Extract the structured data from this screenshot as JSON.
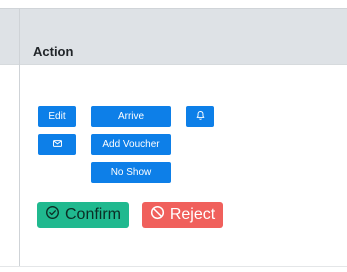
{
  "table": {
    "header": {
      "action_label": "Action"
    }
  },
  "actions": {
    "edit_label": "Edit",
    "arrive_label": "Arrive",
    "add_voucher_label": "Add Voucher",
    "no_show_label": "No Show",
    "confirm_label": "Confirm",
    "reject_label": "Reject",
    "icons": {
      "bell": "bell-icon",
      "mail": "envelope-icon",
      "confirm": "check-circle-icon",
      "reject": "ban-icon"
    }
  },
  "colors": {
    "primary": "#0d7fe8",
    "confirm": "#20b98f",
    "reject": "#f0605c",
    "header_bg": "#dee2e6"
  }
}
